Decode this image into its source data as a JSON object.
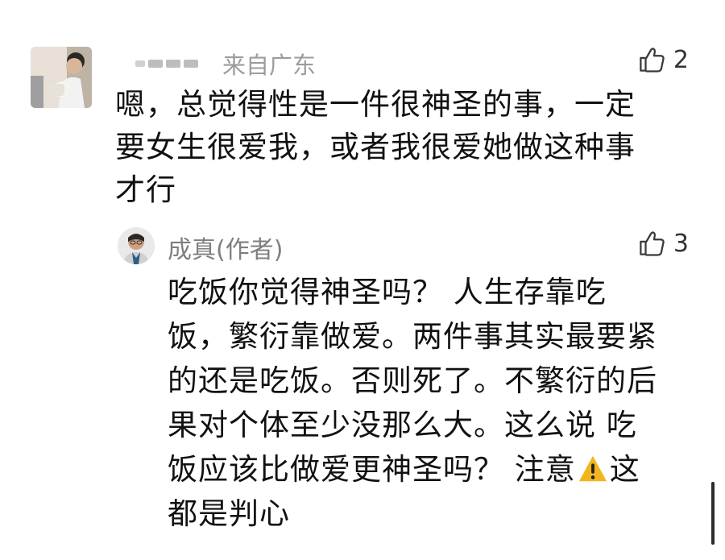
{
  "comment": {
    "location": "来自广东",
    "text": "嗯，总觉得性是一件很神圣的事，一定\n要女生很爱我，或者我很爱她做这种事\n才行",
    "likes": "2"
  },
  "reply": {
    "author": "成真(作者)",
    "text_lines": [
      "吃饭你觉得神圣吗？ 人生存靠吃",
      "饭，繁衍靠做爱。两件事其实最要紧",
      "的还是吃饭。否则死了。不繁衍的后",
      "果对个体至少没那么大。这么说 吃",
      "饭应该比做爱更神圣吗？  注意",
      "这",
      "都是判心"
    ],
    "likes": "3"
  },
  "icons": {
    "like": "thumbs-up-icon",
    "warning": "warning-icon"
  }
}
